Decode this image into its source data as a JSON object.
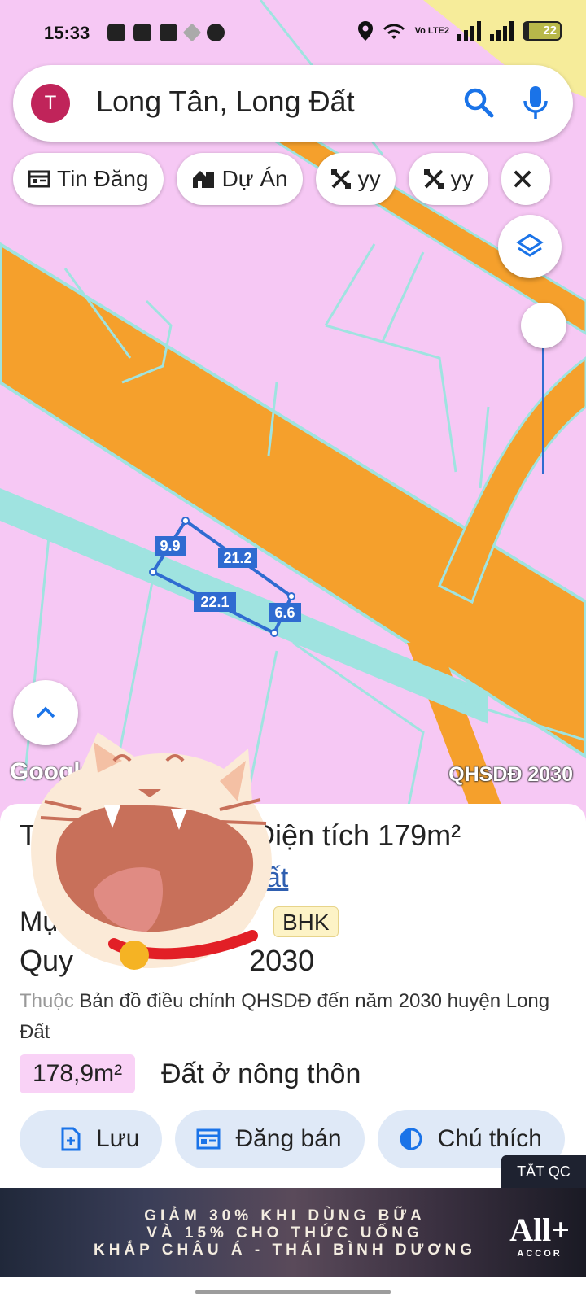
{
  "status_bar": {
    "time": "15:33",
    "network": "Vo LTE2",
    "battery": "22"
  },
  "search": {
    "avatar_letter": "T",
    "query": "Long Tân, Long Đất",
    "search_icon": "search-icon",
    "mic_icon": "mic-icon"
  },
  "chips": [
    {
      "label": "Tin Đăng",
      "icon": "listing-icon"
    },
    {
      "label": "Dự Án",
      "icon": "buildings-icon"
    },
    {
      "label": "yy",
      "icon": "tools-icon"
    },
    {
      "label": "yy",
      "icon": "tools-icon"
    }
  ],
  "map": {
    "attribution": "Google",
    "layer_label": "QHSDĐ 2030",
    "parcel_edges": [
      "9.9",
      "21.2",
      "22.1",
      "6.6"
    ],
    "colors": {
      "land": "#f6c8f4",
      "road": "#f5a02c",
      "boundary": "#9fe3e0",
      "parcel": "#2f6bd1"
    }
  },
  "sheet": {
    "title_fragment": "T",
    "area_label": "Diện tích",
    "area_value": "179m²",
    "link_fragment": "ất",
    "row3_fragment": "Mụ",
    "badge": "BHK",
    "row4_prefix": "Quy",
    "row4_suffix": "2030",
    "desc_muted": "Thuộc",
    "desc": "Bản đồ điều chỉnh QHSDĐ đến năm 2030 huyện Long Đất",
    "land_area": "178,9m²",
    "land_type": "Đất ở nông thôn",
    "actions": [
      {
        "label": "Lưu",
        "icon": "add-file-icon"
      },
      {
        "label": "Đăng bán",
        "icon": "post-listing-icon"
      },
      {
        "label": "Chú thích",
        "icon": "legend-icon"
      }
    ]
  },
  "ad": {
    "close_label": "TẮT QC",
    "text_line1": "GIẢM 30% KHI DÙNG BỮA",
    "text_line2": "VÀ 15% CHO THỨC UỐNG",
    "text_line3": "KHẮP CHÂU Á - THÁI BÌNH DƯƠNG",
    "brand": "All+",
    "brand_sub": "ACCOR"
  }
}
